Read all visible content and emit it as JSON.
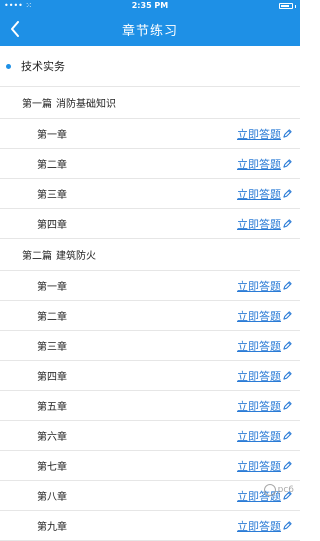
{
  "status_bar": {
    "carrier": "•••• ⁙",
    "time": "2:35 PM",
    "battery_level": 0.8
  },
  "nav": {
    "title": "章节练习",
    "back_icon": "chevron-left-icon"
  },
  "section": {
    "title": "技术实务"
  },
  "colors": {
    "accent": "#1e90e6",
    "link": "#2a7bd6"
  },
  "parts": [
    {
      "part": "第一篇",
      "name": "消防基础知识",
      "chapters": [
        {
          "name": "第一章",
          "action": "立即答题"
        },
        {
          "name": "第二章",
          "action": "立即答题"
        },
        {
          "name": "第三章",
          "action": "立即答题"
        },
        {
          "name": "第四章",
          "action": "立即答题"
        }
      ]
    },
    {
      "part": "第二篇",
      "name": "建筑防火",
      "chapters": [
        {
          "name": "第一章",
          "action": "立即答题"
        },
        {
          "name": "第二章",
          "action": "立即答题"
        },
        {
          "name": "第三章",
          "action": "立即答题"
        },
        {
          "name": "第四章",
          "action": "立即答题"
        },
        {
          "name": "第五章",
          "action": "立即答题"
        },
        {
          "name": "第六章",
          "action": "立即答题"
        },
        {
          "name": "第七章",
          "action": "立即答题"
        },
        {
          "name": "第八章",
          "action": "立即答题"
        },
        {
          "name": "第九章",
          "action": "立即答题"
        }
      ]
    }
  ],
  "watermark": {
    "text": "pc6"
  }
}
